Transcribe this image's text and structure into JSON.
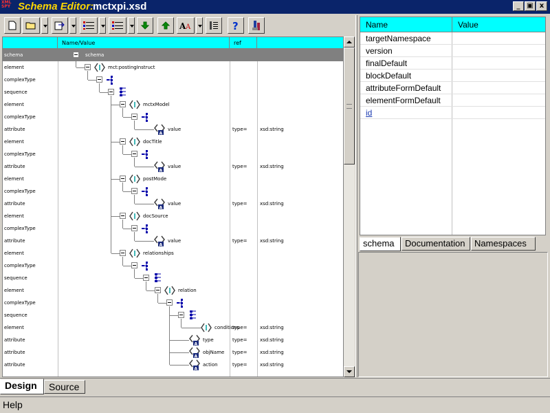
{
  "window": {
    "title_app": "Schema Editor:",
    "title_file": "mctxpi.xsd",
    "controls": [
      "_",
      "▣",
      "x"
    ]
  },
  "toolbar": {
    "buttons": [
      "new-file",
      "open-folder",
      "import",
      "list-ordered",
      "list-outline",
      "move-down",
      "move-up",
      "font-style",
      "text-align",
      "help",
      "tool"
    ]
  },
  "grid": {
    "headers": [
      "Name/Value",
      "ref"
    ],
    "rows": [
      {
        "kind": "schema",
        "name": "schema",
        "depth": 0,
        "icon": "none",
        "a1": "",
        "a2": ""
      },
      {
        "kind": "element",
        "name": "mct:postingInstruct",
        "depth": 1,
        "icon": "element",
        "a1": "",
        "a2": ""
      },
      {
        "kind": "complexType",
        "name": "",
        "depth": 2,
        "icon": "complex",
        "a1": "",
        "a2": ""
      },
      {
        "kind": "sequence",
        "name": "",
        "depth": 3,
        "icon": "sequence",
        "a1": "",
        "a2": ""
      },
      {
        "kind": "element",
        "name": "mctxModel",
        "depth": 4,
        "icon": "element",
        "a1": "",
        "a2": ""
      },
      {
        "kind": "complexType",
        "name": "",
        "depth": 5,
        "icon": "complex",
        "a1": "",
        "a2": ""
      },
      {
        "kind": "attribute",
        "name": "value",
        "depth": 6,
        "icon": "attribute",
        "a1": "type=",
        "a2": "xsd:string"
      },
      {
        "kind": "element",
        "name": "docTitle",
        "depth": 4,
        "icon": "element",
        "a1": "",
        "a2": ""
      },
      {
        "kind": "complexType",
        "name": "",
        "depth": 5,
        "icon": "complex",
        "a1": "",
        "a2": ""
      },
      {
        "kind": "attribute",
        "name": "value",
        "depth": 6,
        "icon": "attribute",
        "a1": "type=",
        "a2": "xsd:string"
      },
      {
        "kind": "element",
        "name": "postMode",
        "depth": 4,
        "icon": "element",
        "a1": "",
        "a2": ""
      },
      {
        "kind": "complexType",
        "name": "",
        "depth": 5,
        "icon": "complex",
        "a1": "",
        "a2": ""
      },
      {
        "kind": "attribute",
        "name": "value",
        "depth": 6,
        "icon": "attribute",
        "a1": "type=",
        "a2": "xsd:string"
      },
      {
        "kind": "element",
        "name": "docSource",
        "depth": 4,
        "icon": "element",
        "a1": "",
        "a2": ""
      },
      {
        "kind": "complexType",
        "name": "",
        "depth": 5,
        "icon": "complex",
        "a1": "",
        "a2": ""
      },
      {
        "kind": "attribute",
        "name": "value",
        "depth": 6,
        "icon": "attribute",
        "a1": "type=",
        "a2": "xsd:string"
      },
      {
        "kind": "element",
        "name": "relationships",
        "depth": 4,
        "icon": "element",
        "a1": "",
        "a2": ""
      },
      {
        "kind": "complexType",
        "name": "",
        "depth": 5,
        "icon": "complex",
        "a1": "",
        "a2": ""
      },
      {
        "kind": "sequence",
        "name": "",
        "depth": 6,
        "icon": "sequence",
        "a1": "",
        "a2": ""
      },
      {
        "kind": "element",
        "name": "relation",
        "depth": 7,
        "icon": "element",
        "a1": "",
        "a2": ""
      },
      {
        "kind": "complexType",
        "name": "",
        "depth": 8,
        "icon": "complex",
        "a1": "",
        "a2": ""
      },
      {
        "kind": "sequence",
        "name": "",
        "depth": 9,
        "icon": "sequence",
        "a1": "",
        "a2": ""
      },
      {
        "kind": "element",
        "name": "conditions",
        "depth": 10,
        "icon": "element",
        "a1": "type=",
        "a2": "xsd:string"
      },
      {
        "kind": "attribute",
        "name": "type",
        "depth": 9,
        "icon": "attribute",
        "a1": "type=",
        "a2": "xsd:string"
      },
      {
        "kind": "attribute",
        "name": "objName",
        "depth": 9,
        "icon": "attribute",
        "a1": "type=",
        "a2": "xsd:string"
      },
      {
        "kind": "attribute",
        "name": "action",
        "depth": 9,
        "icon": "attribute",
        "a1": "type=",
        "a2": "xsd:string"
      }
    ]
  },
  "properties": {
    "headers": [
      "Name",
      "Value"
    ],
    "rows": [
      "targetNamespace",
      "version",
      "finalDefault",
      "blockDefault",
      "attributeFormDefault",
      "elementFormDefault",
      "id"
    ],
    "tabs": [
      "schema",
      "Documentation",
      "Namespaces"
    ]
  },
  "bottom_tabs": [
    "Design",
    "Source"
  ],
  "status": "Help",
  "colors": {
    "header": "#00ffff",
    "title_bar": "#0a246a",
    "title_app": "#ffd700"
  }
}
